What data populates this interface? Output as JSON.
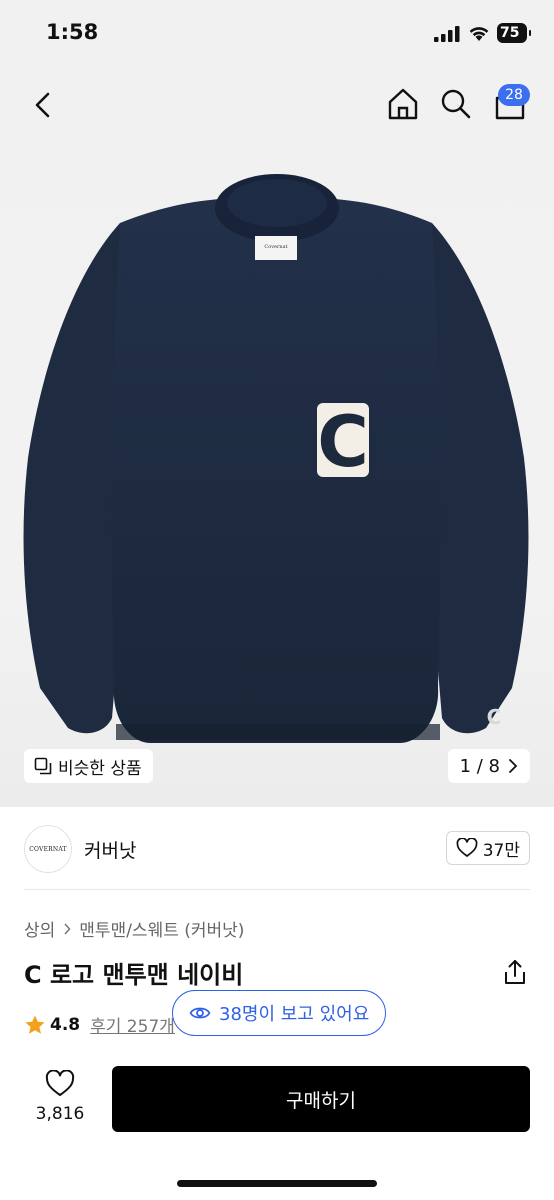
{
  "status_bar": {
    "time": "1:58",
    "battery": "75"
  },
  "header": {
    "cart_count": "28"
  },
  "hero": {
    "similar_label": "비슷한 상품",
    "page_indicator": "1 / 8"
  },
  "brand": {
    "logo_text": "COVERNAT",
    "name": "커버낫",
    "like_count": "37만"
  },
  "breadcrumb": {
    "items": [
      "상의",
      "맨투맨/스웨트 (커버낫)"
    ]
  },
  "product": {
    "title": "C 로고 맨투맨 네이비",
    "rating": "4.8",
    "reviews_label": "후기 257개"
  },
  "viewers": {
    "label": "38명이 보고 있어요"
  },
  "bottom": {
    "wish_count": "3,816",
    "buy_label": "구매하기"
  },
  "colors": {
    "accent": "#2f62e6",
    "badge": "#3b6ff0",
    "star": "#f2a11b",
    "sweater": "#1d2a3d"
  }
}
